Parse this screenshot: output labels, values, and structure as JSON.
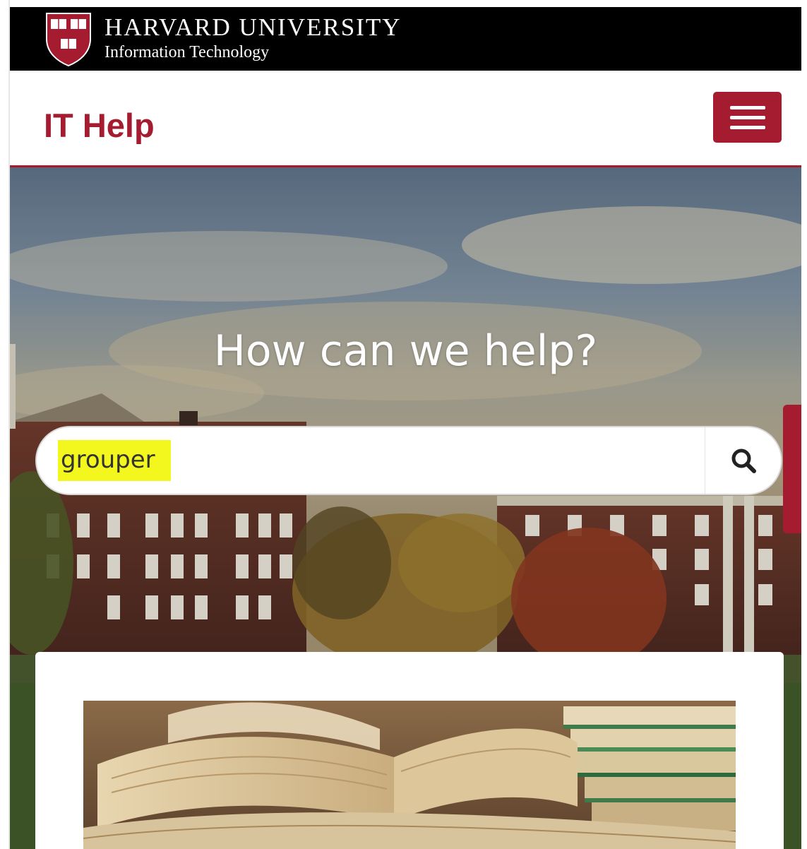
{
  "harvard_bar": {
    "name": "HARVARD UNIVERSITY",
    "department": "Information Technology",
    "shield_icon": "harvard-shield-icon",
    "shield_color": "#a51c30"
  },
  "header": {
    "title": "IT Help",
    "menu_icon": "hamburger-menu-icon",
    "accent_color": "#a51c30"
  },
  "hero": {
    "heading": "How can we help?"
  },
  "search": {
    "value": "grouper",
    "highlight_color": "#f3f71e",
    "submit_icon": "search-icon"
  },
  "card": {
    "image": "open-books-image"
  }
}
